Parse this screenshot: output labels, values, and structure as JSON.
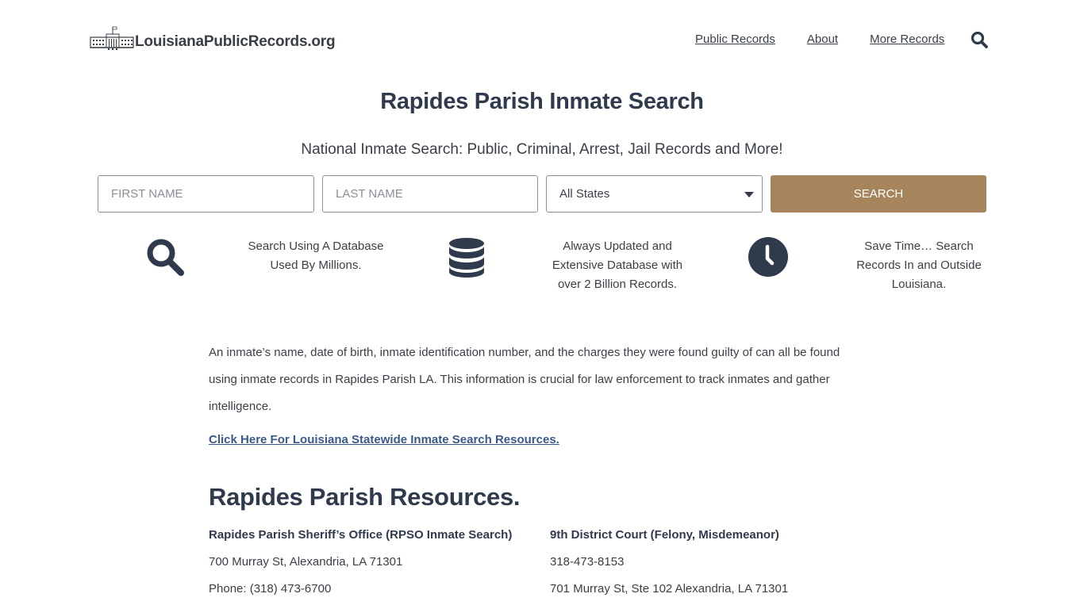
{
  "header": {
    "logo_text": "LouisianaPublicRecords.org",
    "logo_icon": "capitol-building-icon",
    "nav": [
      {
        "label": "Public Records"
      },
      {
        "label": "About"
      },
      {
        "label": "More Records"
      }
    ],
    "search_icon": "search-icon"
  },
  "page": {
    "title": "Rapides Parish Inmate Search",
    "subtitle": "National Inmate Search: Public, Criminal, Arrest, Jail Records and More!"
  },
  "search_form": {
    "first_name_placeholder": "FIRST NAME",
    "first_name_value": "",
    "last_name_placeholder": "LAST NAME",
    "last_name_value": "",
    "state_selected": "All States",
    "search_label": "SEARCH"
  },
  "features": [
    {
      "icon": "search-icon",
      "line1": "Search Using A Database",
      "line2": "Used By Millions.",
      "line3": ""
    },
    {
      "icon": "database-icon",
      "line1": "Always Updated and",
      "line2": "Extensive Database with",
      "line3": "over 2 Billion Records."
    },
    {
      "icon": "clock-icon",
      "line1": "Save Time… Search",
      "line2": "Records In and Outside",
      "line3": "Louisiana."
    }
  ],
  "content": {
    "intro_line1": "An inmate’s name, date of birth, inmate identification number, and the charges they were found guilty of can all be found",
    "intro_line2": "using inmate records in Rapides Parish LA. This information is crucial for law enforcement to track inmates and gather",
    "intro_line3": "intelligence.",
    "state_link": "Click Here For Louisiana Statewide Inmate Search Resources.",
    "resources_title": "Rapides Parish Resources.",
    "resources": [
      {
        "name": "Rapides Parish Sheriff’s Office (RPSO Inmate Search)",
        "line1": "700 Murray St, Alexandria, LA 71301",
        "line2": "Phone: (318) 473-6700"
      },
      {
        "name": "9th District Court (Felony, Misdemeanor)",
        "line1": "318-473-8153",
        "line2": "701 Murray St, Ste 102 Alexandria, LA 71301"
      }
    ]
  },
  "colors": {
    "accent": "#a6855d",
    "text": "#3a3f47",
    "heading": "#2f3a4c",
    "link": "#3a5a8a"
  }
}
